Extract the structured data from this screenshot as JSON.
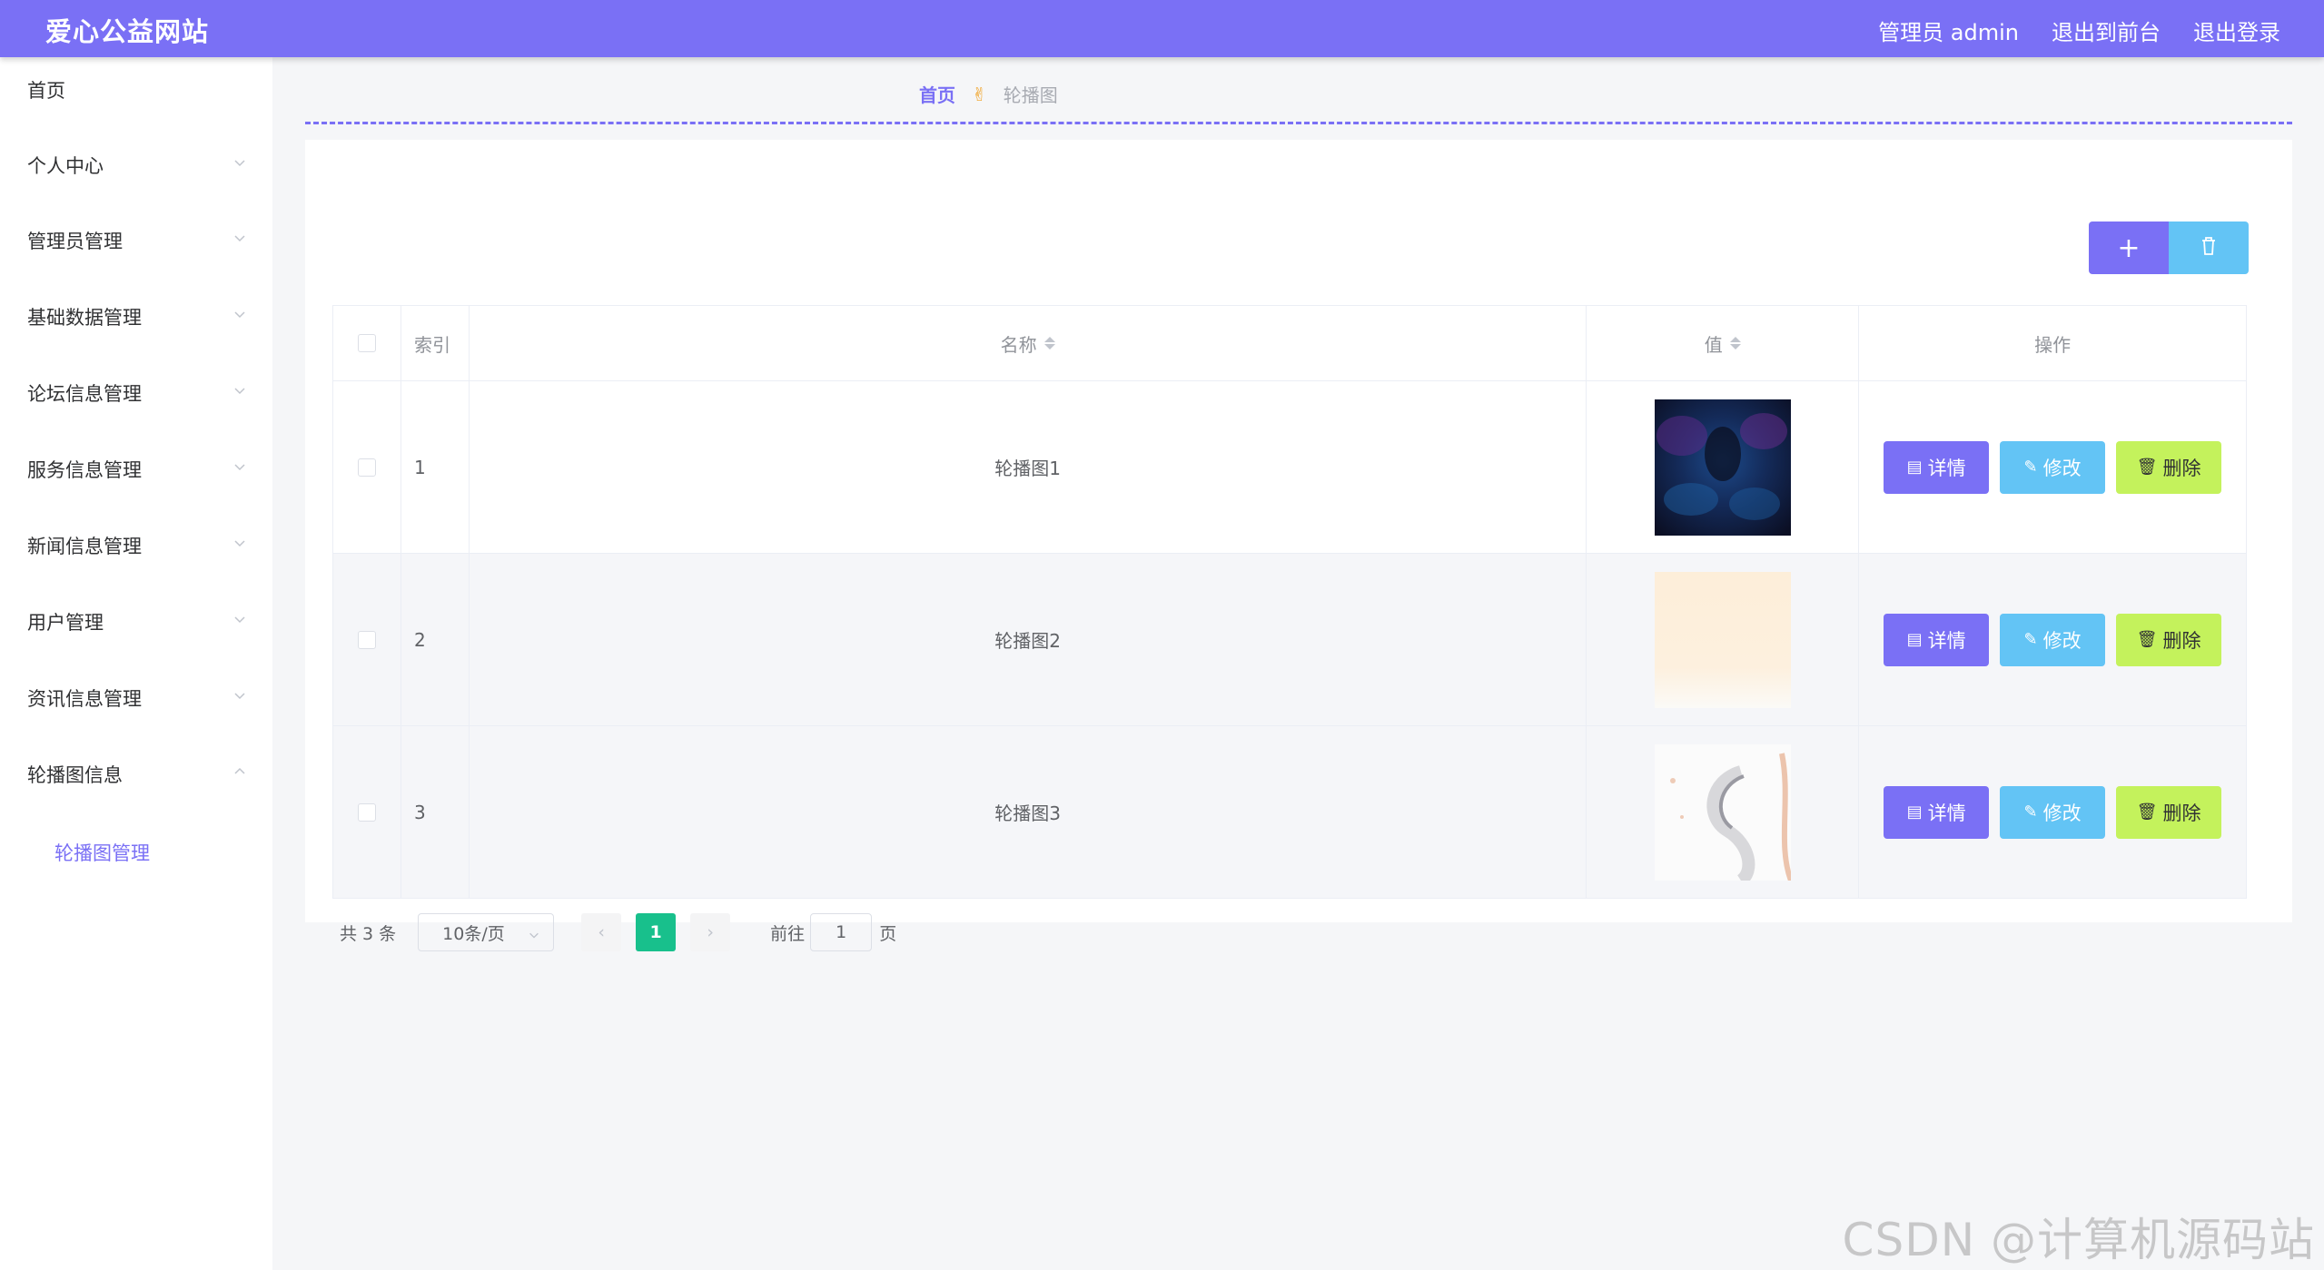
{
  "header": {
    "title": "爱心公益网站",
    "links": [
      "管理员 admin",
      "退出到前台",
      "退出登录"
    ],
    "accent_color": "#7a70f5"
  },
  "sidebar": {
    "items": [
      {
        "label": "首页",
        "icon": "none"
      },
      {
        "label": "个人中心",
        "icon": "chevron-down-icon"
      },
      {
        "label": "管理员管理",
        "icon": "chevron-down-icon"
      },
      {
        "label": "基础数据管理",
        "icon": "chevron-down-icon"
      },
      {
        "label": "论坛信息管理",
        "icon": "chevron-down-icon"
      },
      {
        "label": "服务信息管理",
        "icon": "chevron-down-icon"
      },
      {
        "label": "新闻信息管理",
        "icon": "chevron-down-icon"
      },
      {
        "label": "用户管理",
        "icon": "chevron-down-icon"
      },
      {
        "label": "资讯信息管理",
        "icon": "chevron-down-icon"
      },
      {
        "label": "轮播图信息",
        "icon": "chevron-up-icon"
      }
    ],
    "submenu": {
      "label": "轮播图管理"
    }
  },
  "breadcrumb": {
    "home": "首页",
    "icon": "victory-hand-icon",
    "current": "轮播图"
  },
  "toolbar": {
    "add_icon": "plus-icon",
    "delete_icon": "trash-icon"
  },
  "table": {
    "columns": {
      "index": "索引",
      "name": "名称",
      "value": "值",
      "ops": "操作"
    },
    "rows": [
      {
        "index": "1",
        "name": "轮播图1",
        "thumb": "dark-abstract"
      },
      {
        "index": "2",
        "name": "轮播图2",
        "thumb": "cream-gradient"
      },
      {
        "index": "3",
        "name": "轮播图3",
        "thumb": "white-swirl"
      }
    ],
    "ops": {
      "detail": "详情",
      "edit": "修改",
      "delete": "删除"
    }
  },
  "pagination": {
    "total": "共 3 条",
    "page_size": "10条/页",
    "current_page": "1",
    "goto_label": "前往",
    "goto_value": "1",
    "goto_unit": "页"
  },
  "watermark": "CSDN @计算机源码站"
}
